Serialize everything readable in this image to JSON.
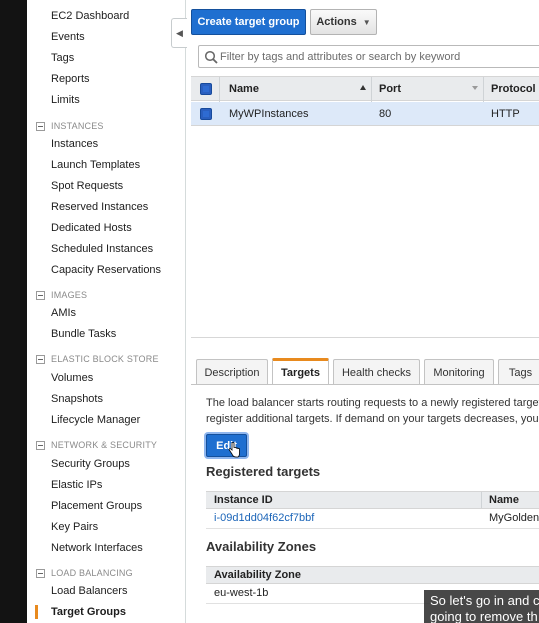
{
  "sidebar": {
    "items": [
      {
        "label": "EC2 Dashboard",
        "type": "item"
      },
      {
        "label": "Events",
        "type": "item"
      },
      {
        "label": "Tags",
        "type": "item"
      },
      {
        "label": "Reports",
        "type": "item"
      },
      {
        "label": "Limits",
        "type": "item"
      },
      {
        "label": "INSTANCES",
        "type": "head"
      },
      {
        "label": "Instances",
        "type": "item"
      },
      {
        "label": "Launch Templates",
        "type": "item"
      },
      {
        "label": "Spot Requests",
        "type": "item"
      },
      {
        "label": "Reserved Instances",
        "type": "item"
      },
      {
        "label": "Dedicated Hosts",
        "type": "item"
      },
      {
        "label": "Scheduled Instances",
        "type": "item"
      },
      {
        "label": "Capacity Reservations",
        "type": "item"
      },
      {
        "label": "IMAGES",
        "type": "head"
      },
      {
        "label": "AMIs",
        "type": "item"
      },
      {
        "label": "Bundle Tasks",
        "type": "item"
      },
      {
        "label": "ELASTIC BLOCK STORE",
        "type": "head"
      },
      {
        "label": "Volumes",
        "type": "item"
      },
      {
        "label": "Snapshots",
        "type": "item"
      },
      {
        "label": "Lifecycle Manager",
        "type": "item"
      },
      {
        "label": "NETWORK & SECURITY",
        "type": "head"
      },
      {
        "label": "Security Groups",
        "type": "item"
      },
      {
        "label": "Elastic IPs",
        "type": "item"
      },
      {
        "label": "Placement Groups",
        "type": "item"
      },
      {
        "label": "Key Pairs",
        "type": "item"
      },
      {
        "label": "Network Interfaces",
        "type": "item"
      },
      {
        "label": "LOAD BALANCING",
        "type": "head"
      },
      {
        "label": "Load Balancers",
        "type": "item"
      },
      {
        "label": "Target Groups",
        "type": "item",
        "active": true
      }
    ]
  },
  "toolbar": {
    "create_label": "Create target group",
    "actions_label": "Actions"
  },
  "search": {
    "placeholder": "Filter by tags and attributes or search by keyword"
  },
  "target_groups_table": {
    "columns": [
      "Name",
      "Port",
      "Protocol"
    ],
    "rows": [
      {
        "name": "MyWPInstances",
        "port": "80",
        "protocol": "HTTP",
        "selected": true
      }
    ]
  },
  "tabs": [
    {
      "label": "Description"
    },
    {
      "label": "Targets",
      "active": true
    },
    {
      "label": "Health checks"
    },
    {
      "label": "Monitoring"
    },
    {
      "label": "Tags"
    }
  ],
  "targets_panel": {
    "description_line1": "The load balancer starts routing requests to a newly registered target as",
    "description_line2": "register additional targets. If demand on your targets decreases, you ca",
    "edit_label": "Edit",
    "registered_title": "Registered targets",
    "registered_columns": [
      "Instance ID",
      "Name"
    ],
    "registered_rows": [
      {
        "instance_id": "i-09d1dd04f62cf7bbf",
        "name": "MyGoldenIn"
      }
    ],
    "az_title": "Availability Zones",
    "az_column": "Availability Zone",
    "az_rows": [
      "eu-west-1b"
    ]
  },
  "caption": {
    "line1": "So let's go in and c",
    "line2": "going to remove th"
  },
  "colors": {
    "primary_button": "#1f6fd0",
    "active_tab_accent": "#e88a1e",
    "selected_row": "#dde9f9",
    "link": "#1a64b8"
  }
}
